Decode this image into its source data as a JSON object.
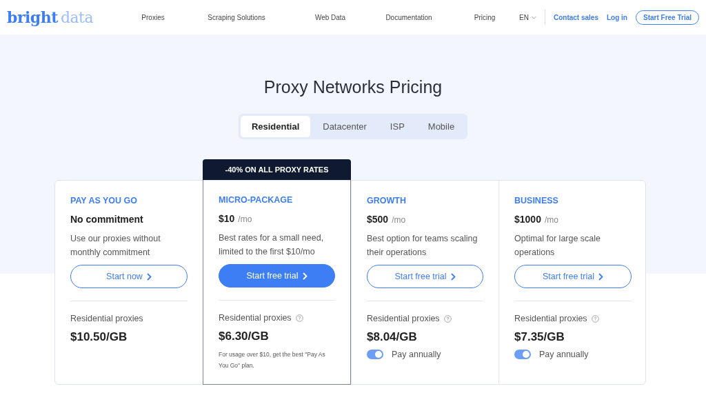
{
  "logo": {
    "part1": "bright",
    "part2": "data"
  },
  "nav": {
    "links": [
      "Proxies",
      "Scraping Solutions",
      "Web Data",
      "Documentation",
      "Pricing"
    ],
    "language": "EN",
    "contact": "Contact sales",
    "login": "Log in",
    "cta": "Start Free Trial"
  },
  "title": "Proxy Networks Pricing",
  "tabs": [
    {
      "label": "Residential",
      "selected": true
    },
    {
      "label": "Datacenter",
      "selected": false
    },
    {
      "label": "ISP",
      "selected": false
    },
    {
      "label": "Mobile",
      "selected": false
    }
  ],
  "plans": [
    {
      "name": "PAY AS YOU GO",
      "headline": "No commitment",
      "description": "Use our proxies without monthly commitment",
      "button": "Start now",
      "featured": false,
      "proxy_label": "Residential proxies",
      "info_icon": false,
      "rate": "$10.50/GB"
    },
    {
      "name": "MICRO-PACKAGE",
      "price": "$10",
      "period": "/mo",
      "description": "Best rates for a small need, limited to the first $10/mo",
      "button": "Start free trial",
      "featured": true,
      "badge": "-40% ON ALL PROXY RATES",
      "proxy_label": "Residential proxies",
      "info_icon": true,
      "rate": "$6.30/GB",
      "note": "For usage over $10, get the best \"Pay As You Go\" plan."
    },
    {
      "name": "GROWTH",
      "price": "$500",
      "period": "/mo",
      "description": "Best option for teams scaling their operations",
      "button": "Start free trial",
      "featured": false,
      "proxy_label": "Residential proxies",
      "info_icon": true,
      "rate": "$8.04/GB",
      "toggle": {
        "label": "Pay annually",
        "on": true
      }
    },
    {
      "name": "BUSINESS",
      "price": "$1000",
      "period": "/mo",
      "description": "Optimal for large scale operations",
      "button": "Start free trial",
      "featured": false,
      "proxy_label": "Residential proxies",
      "info_icon": true,
      "rate": "$7.35/GB",
      "toggle": {
        "label": "Pay annually",
        "on": true
      }
    }
  ]
}
